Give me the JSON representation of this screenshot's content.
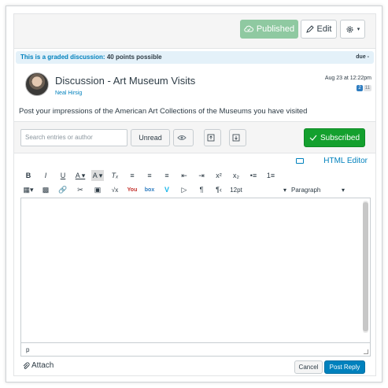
{
  "toolbar": {
    "published_label": "Published",
    "edit_label": "Edit",
    "settings_caret": "▾"
  },
  "banner": {
    "graded_text": "This is a graded discussion:",
    "points_text": "40 points possible",
    "due_text": "due -"
  },
  "topic": {
    "title": "Discussion - Art Museum Visits",
    "author": "Neal Hirsig",
    "date": "Aug 23 at 12:22pm",
    "unread_count": "2",
    "total_count": "11",
    "message": "Post your impressions of the American Art Collections of the Museums you have visited"
  },
  "controls": {
    "search_placeholder": "Search entries or author",
    "unread_label": "Unread",
    "subscribed_label": "Subscribed"
  },
  "editor": {
    "html_editor_label": "HTML Editor",
    "font_size": "12pt",
    "paragraph": "Paragraph",
    "path": "p"
  },
  "footer": {
    "attach_label": "Attach",
    "cancel_label": "Cancel",
    "post_reply_label": "Post Reply"
  },
  "colors": {
    "published": "#8fc9a1",
    "subscribed": "#14a02e",
    "link": "#0081bd",
    "post_reply": "#0081bd"
  }
}
